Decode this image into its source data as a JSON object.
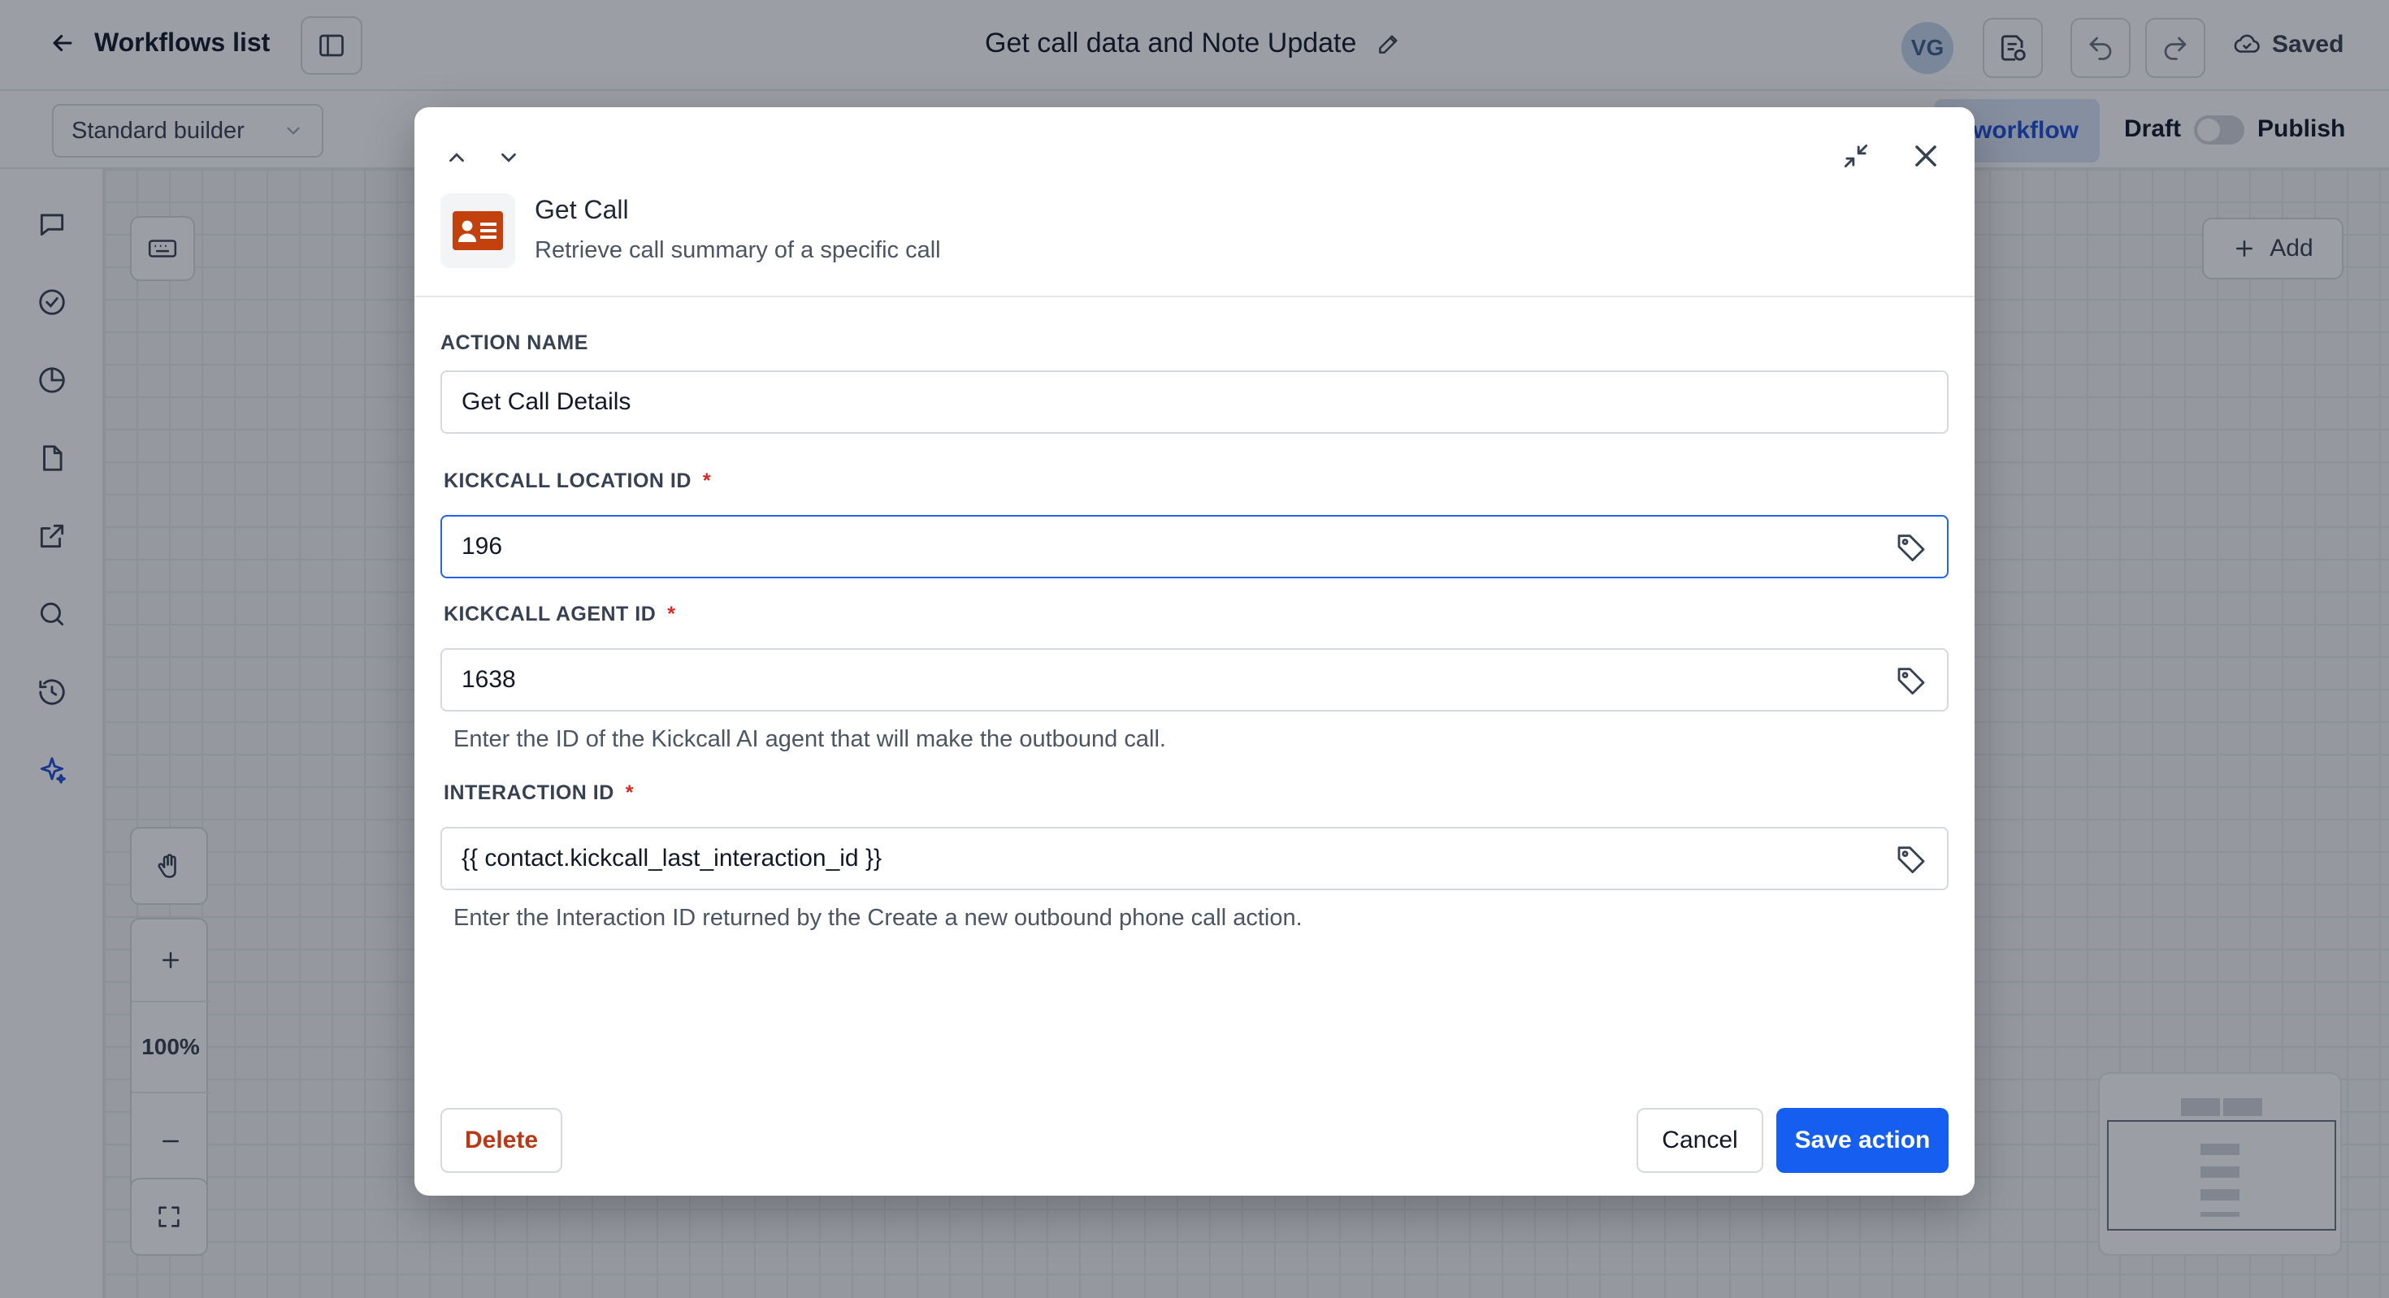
{
  "header": {
    "back_label": "Workflows list",
    "workflow_title": "Get call data and Note Update",
    "avatar_initials": "VG",
    "saved_label": "Saved"
  },
  "subbar": {
    "builder_mode": "Standard builder",
    "test_workflow_label": "workflow",
    "draft_label": "Draft",
    "publish_label": "Publish",
    "publish_toggle_on": false
  },
  "rail": {
    "items": [
      "chat-icon",
      "check-circle-icon",
      "pie-chart-icon",
      "file-icon",
      "external-link-icon",
      "search-icon",
      "history-icon",
      "sparkle-icon"
    ]
  },
  "canvas": {
    "add_label": "Add",
    "zoom_level": "100%"
  },
  "modal": {
    "action_title": "Get Call",
    "action_description": "Retrieve call summary of a specific call",
    "fields": {
      "action_name": {
        "label": "ACTION NAME",
        "value": "Get Call Details"
      },
      "location_id": {
        "label": "KICKCALL LOCATION ID",
        "value": "196",
        "required": "*"
      },
      "agent_id": {
        "label": "KICKCALL AGENT ID",
        "value": "1638",
        "required": "*",
        "help": "Enter the ID of the Kickcall AI agent that will make the outbound call."
      },
      "interaction_id": {
        "label": "INTERACTION ID",
        "value": "{{ contact.kickcall_last_interaction_id }}",
        "required": "*",
        "help": "Enter the Interaction ID returned by the Create a new outbound phone call action."
      }
    },
    "buttons": {
      "delete": "Delete",
      "cancel": "Cancel",
      "save": "Save action"
    }
  },
  "colors": {
    "primary": "#155eef",
    "danger": "#b93815",
    "required": "#dc2626",
    "action_icon": "#c2410c"
  }
}
